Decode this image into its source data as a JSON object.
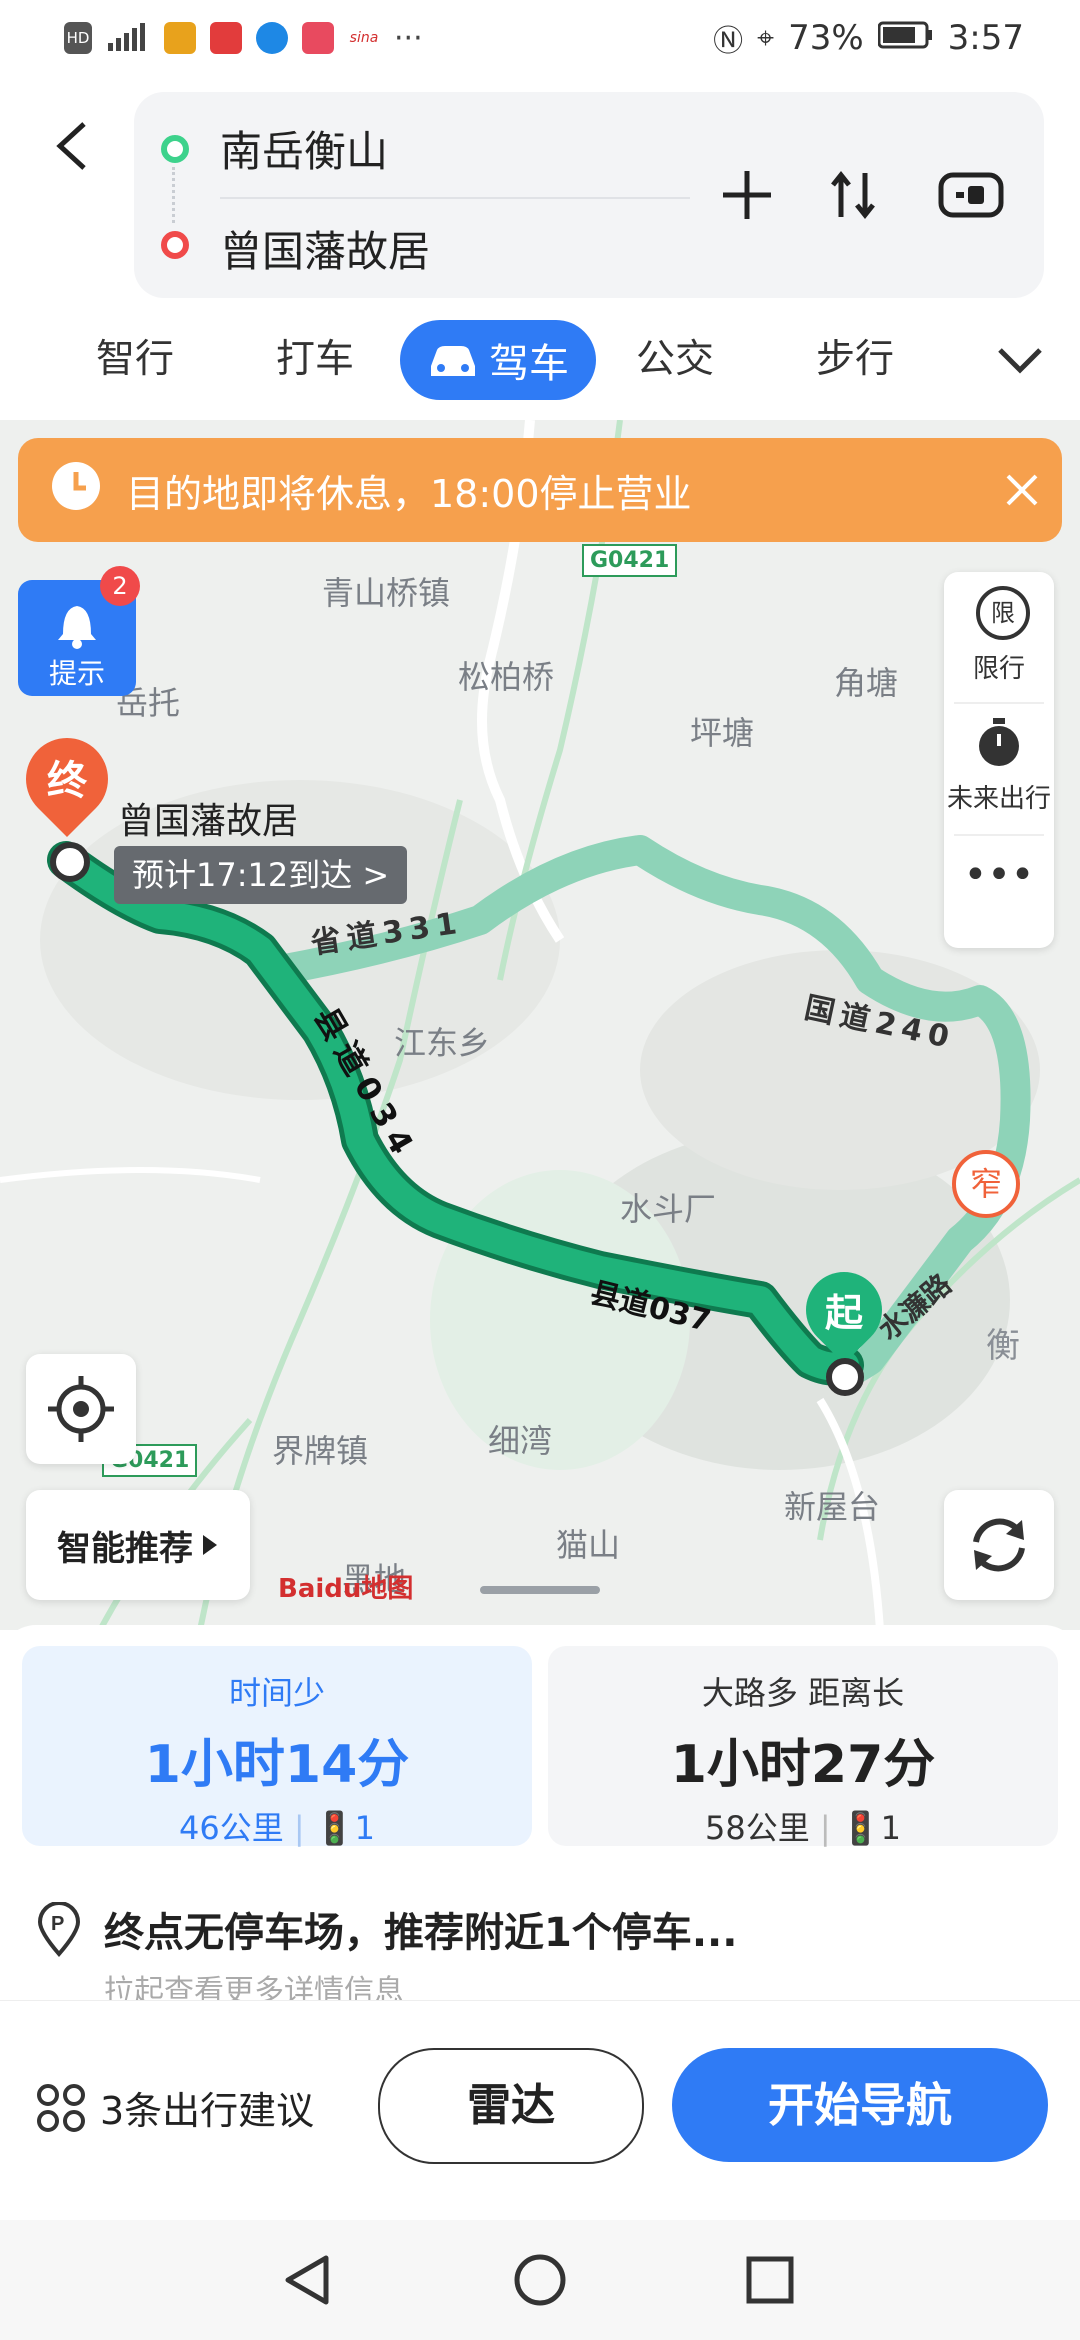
{
  "status_bar": {
    "battery": "73%",
    "time": "3:57"
  },
  "route": {
    "start": "南岳衡山",
    "end": "曾国藩故居"
  },
  "tabs": [
    "智行",
    "打车",
    "驾车",
    "公交",
    "步行"
  ],
  "notice": {
    "text": "目的地即将休息，18:00停止营业"
  },
  "map": {
    "tip_label": "提示",
    "tip_badge": "2",
    "restrict_label": "限行",
    "restrict_icon_text": "限",
    "future_label": "未来出行",
    "smart_recommend": "智能推荐",
    "dest_marker": "终",
    "dest_name": "曾国藩故居",
    "eta": "预计17:12到达 >",
    "start_marker": "起",
    "narrow_tag": "窄",
    "logo": "Baidu地图",
    "places": [
      "青山桥镇",
      "松柏桥",
      "角塘",
      "坪塘",
      "岳托",
      "江东乡",
      "水斗厂",
      "界牌镇",
      "细湾",
      "新屋台",
      "猫山",
      "黑地",
      "衡"
    ],
    "roads": [
      "G0421",
      "G0421",
      "省道331",
      "国道240",
      "县道034",
      "县道037",
      "水濂路"
    ]
  },
  "routes": [
    {
      "tag": "时间少",
      "time": "1小时14分",
      "distance": "46公里",
      "lights": "1"
    },
    {
      "tag": "大路多  距离长",
      "time": "1小时27分",
      "distance": "58公里",
      "lights": "1"
    }
  ],
  "parking": {
    "text": "终点无停车场，推荐附近1个停车...",
    "sub": "拉起查看更多详情信息"
  },
  "bottom": {
    "suggest": "3条出行建议",
    "radar": "雷达",
    "start_nav": "开始导航"
  },
  "colors": {
    "accent": "#2f7bf5",
    "route_main": "#1fb37a",
    "route_alt": "#8ed3b8",
    "notice": "#f6a04d"
  }
}
